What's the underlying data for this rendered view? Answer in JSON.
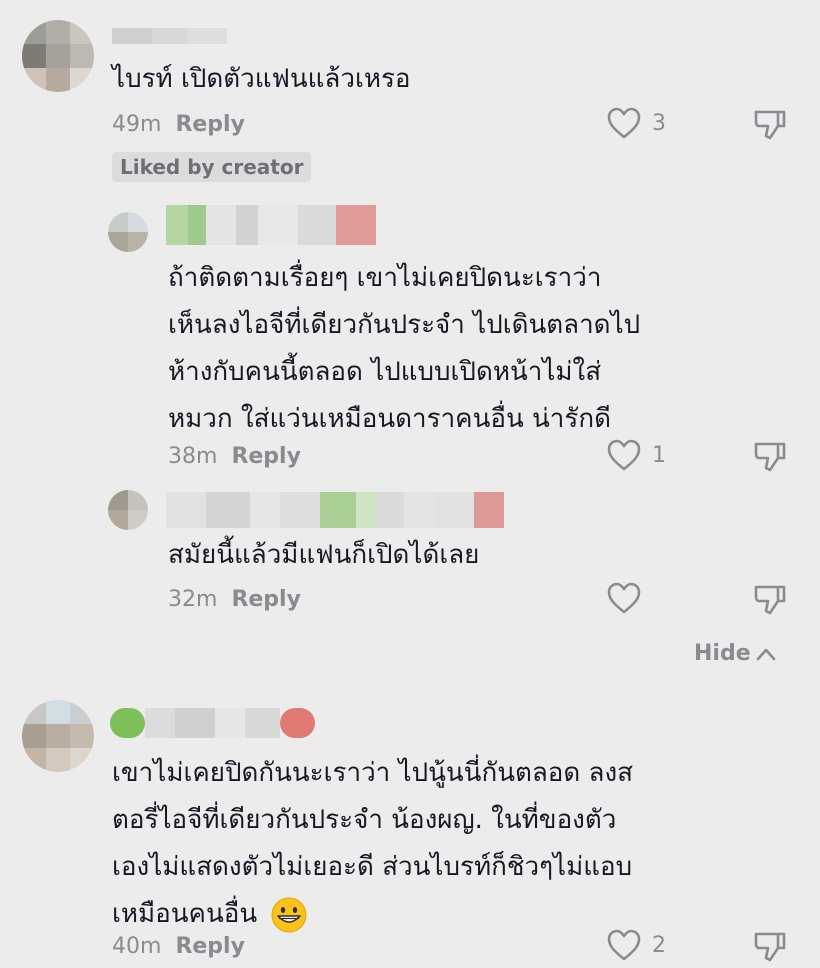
{
  "comments": [
    {
      "text": "ไบรท์ เปิดตัวแฟนแล้วเหรอ",
      "time": "49m",
      "reply_label": "Reply",
      "likes": "3",
      "badge": "Liked by creator"
    },
    {
      "lines": [
        "ถ้าติดตามเรื่อยๆ เขาไม่เคยปิดนะเราว่า",
        "เห็นลงไอจีที่เดียวกันประจำ ไปเดินตลาดไป",
        "ห้างกับคนนี้ตลอด ไปแบบเปิดหน้าไม่ใส่",
        "หมวก ใส่แว่นเหมือนดาราคนอื่น น่ารักดี"
      ],
      "time": "38m",
      "reply_label": "Reply",
      "likes": "1"
    },
    {
      "text": "สมัยนี้แล้วมีแฟนก็เปิดได้เลย",
      "time": "32m",
      "reply_label": "Reply",
      "likes": ""
    },
    {
      "lines": [
        "เขาไม่เคยปิดกันนะเราว่า ไปนู้นนี่กันตลอด ลงส",
        "ตอรี่ไอจีที่เดียวกันประจำ น้องผญ. ในที่ของตัว",
        "เองไม่แสดงตัวไม่เยอะดี ส่วนไบรท์ก็ชิวๆไม่แอบ",
        "เหมือนคนอื่น"
      ],
      "emoji": "grinning-face-emoji",
      "time": "40m",
      "reply_label": "Reply",
      "likes": "2"
    }
  ],
  "hide_label": "Hide",
  "icons": [
    "heart-icon",
    "dislike-icon",
    "chevron-up-icon"
  ],
  "colors": {
    "background": "#ececec",
    "text": "#161823",
    "meta": "#8a8b91"
  }
}
